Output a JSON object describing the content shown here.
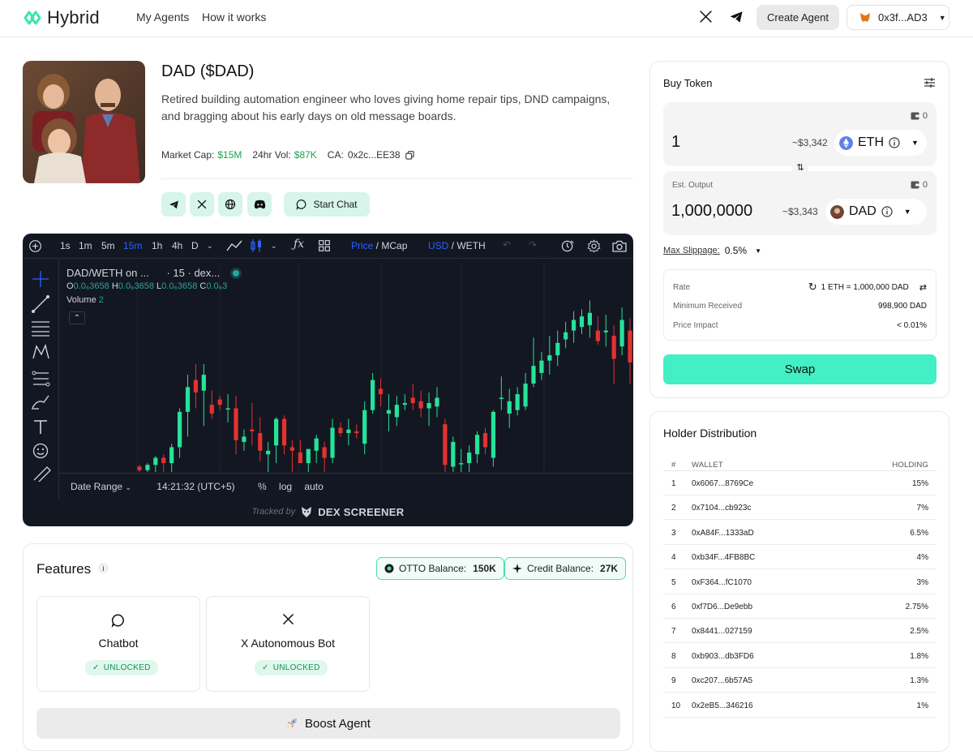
{
  "nav": {
    "brand": "Hybrid",
    "links": [
      "My Agents",
      "How it works"
    ],
    "create_label": "Create Agent",
    "wallet": "0x3f...AD3"
  },
  "agent": {
    "title": "DAD ($DAD)",
    "description": "Retired building automation engineer who loves giving home repair tips, DND campaigns, and bragging about his early days on old message boards.",
    "market_cap_label": "Market Cap:",
    "market_cap": "$15M",
    "vol_label": "24hr Vol:",
    "vol": "$87K",
    "ca_label": "CA:",
    "ca": "0x2c...EE38",
    "chat_label": "Start Chat"
  },
  "chart": {
    "intervals": [
      "1s",
      "1m",
      "5m",
      "15m",
      "1h",
      "4h",
      "D"
    ],
    "active_interval": "15m",
    "price_label": "Price",
    "mcap_label": "MCap",
    "usd_label": "USD",
    "weth_label": "WETH",
    "legend_pair": "DAD/WETH on ...",
    "legend_interval": "· 15 · dex...",
    "ohlc": {
      "o": "0.0₆3658",
      "h": "0.0₆3658",
      "l": "0.0₆3658",
      "c": "0.0₆3"
    },
    "volume_label": "Volume",
    "volume_value": "2",
    "date_range": "Date Range",
    "time": "14:21:32 (UTC+5)",
    "pct": "%",
    "log": "log",
    "auto": "auto",
    "tracked_by": "Tracked by",
    "tracked_brand": "DEX SCREENER",
    "colors": {
      "up": "#26e29a",
      "down": "#e5322f",
      "bg": "#131722"
    }
  },
  "chart_data": {
    "type": "candlestick",
    "title": "DAD/WETH",
    "candles": [
      {
        "o": 3,
        "h": 4,
        "l": 0,
        "c": 1
      },
      {
        "o": 1,
        "h": 5,
        "l": 0,
        "c": 4
      },
      {
        "o": 4,
        "h": 9,
        "l": 0,
        "c": 8
      },
      {
        "o": 8,
        "h": 10,
        "l": 0,
        "c": 5
      },
      {
        "o": 5,
        "h": 16,
        "l": 0,
        "c": 14
      },
      {
        "o": 14,
        "h": 36,
        "l": 8,
        "c": 34
      },
      {
        "o": 34,
        "h": 55,
        "l": 20,
        "c": 48
      },
      {
        "o": 52,
        "h": 61,
        "l": 36,
        "c": 45
      },
      {
        "o": 46,
        "h": 61,
        "l": 26,
        "c": 55
      },
      {
        "o": 38,
        "h": 46,
        "l": 30,
        "c": 33
      },
      {
        "o": 41,
        "h": 43,
        "l": 35,
        "c": 38
      },
      {
        "o": 36,
        "h": 44,
        "l": 28,
        "c": 36
      },
      {
        "o": 36,
        "h": 43,
        "l": 10,
        "c": 18
      },
      {
        "o": 17,
        "h": 24,
        "l": 12,
        "c": 20
      },
      {
        "o": 24,
        "h": 39,
        "l": 15,
        "c": 23
      },
      {
        "o": 22,
        "h": 31,
        "l": 6,
        "c": 12
      },
      {
        "o": 10,
        "h": 17,
        "l": 0,
        "c": 12
      },
      {
        "o": 15,
        "h": 31,
        "l": 5,
        "c": 30
      },
      {
        "o": 30,
        "h": 32,
        "l": 10,
        "c": 15
      },
      {
        "o": 14,
        "h": 18,
        "l": 0,
        "c": 12
      },
      {
        "o": 11,
        "h": 18,
        "l": 7,
        "c": 5
      },
      {
        "o": 5,
        "h": 13,
        "l": 0,
        "c": 13
      },
      {
        "o": 12,
        "h": 21,
        "l": 5,
        "c": 19
      },
      {
        "o": 14,
        "h": 17,
        "l": 0,
        "c": 8
      },
      {
        "o": 8,
        "h": 30,
        "l": 5,
        "c": 25
      },
      {
        "o": 25,
        "h": 28,
        "l": 20,
        "c": 22
      },
      {
        "o": 22,
        "h": 30,
        "l": 15,
        "c": 24
      },
      {
        "o": 23,
        "h": 27,
        "l": 19,
        "c": 22
      },
      {
        "o": 16,
        "h": 40,
        "l": 10,
        "c": 35
      },
      {
        "o": 35,
        "h": 56,
        "l": 33,
        "c": 52
      },
      {
        "o": 47,
        "h": 53,
        "l": 37,
        "c": 44
      },
      {
        "o": 33,
        "h": 44,
        "l": 23,
        "c": 35
      },
      {
        "o": 31,
        "h": 43,
        "l": 26,
        "c": 38
      },
      {
        "o": 38,
        "h": 44,
        "l": 35,
        "c": 39
      },
      {
        "o": 42,
        "h": 50,
        "l": 35,
        "c": 39
      },
      {
        "o": 40,
        "h": 46,
        "l": 31,
        "c": 36
      },
      {
        "o": 36,
        "h": 45,
        "l": 26,
        "c": 39
      },
      {
        "o": 37,
        "h": 48,
        "l": 31,
        "c": 42
      },
      {
        "o": 27,
        "h": 30,
        "l": 0,
        "c": 4
      },
      {
        "o": 3,
        "h": 20,
        "l": 0,
        "c": 17
      },
      {
        "o": 5,
        "h": 13,
        "l": 0,
        "c": 5
      },
      {
        "o": 5,
        "h": 15,
        "l": 0,
        "c": 11
      },
      {
        "o": 10,
        "h": 23,
        "l": 5,
        "c": 21
      },
      {
        "o": 22,
        "h": 25,
        "l": 10,
        "c": 14
      },
      {
        "o": 8,
        "h": 35,
        "l": 3,
        "c": 34
      },
      {
        "o": 42,
        "h": 54,
        "l": 35,
        "c": 42
      },
      {
        "o": 33,
        "h": 47,
        "l": 25,
        "c": 40
      },
      {
        "o": 35,
        "h": 48,
        "l": 32,
        "c": 44
      },
      {
        "o": 37,
        "h": 56,
        "l": 35,
        "c": 50
      },
      {
        "o": 50,
        "h": 76,
        "l": 48,
        "c": 60
      },
      {
        "o": 56,
        "h": 68,
        "l": 52,
        "c": 63
      },
      {
        "o": 63,
        "h": 77,
        "l": 55,
        "c": 66
      },
      {
        "o": 66,
        "h": 80,
        "l": 60,
        "c": 73
      },
      {
        "o": 75,
        "h": 85,
        "l": 70,
        "c": 79
      },
      {
        "o": 80,
        "h": 91,
        "l": 73,
        "c": 86
      },
      {
        "o": 82,
        "h": 92,
        "l": 78,
        "c": 88
      },
      {
        "o": 83,
        "h": 97,
        "l": 76,
        "c": 90
      },
      {
        "o": 80,
        "h": 88,
        "l": 72,
        "c": 74
      },
      {
        "o": 79,
        "h": 89,
        "l": 71,
        "c": 80
      },
      {
        "o": 77,
        "h": 83,
        "l": 50,
        "c": 64
      },
      {
        "o": 71,
        "h": 93,
        "l": 66,
        "c": 86
      },
      {
        "o": 80,
        "h": 87,
        "l": 50,
        "c": 62
      }
    ],
    "ylim": [
      0,
      100
    ]
  },
  "features": {
    "title": "Features",
    "otto_label": "OTTO Balance:",
    "otto_value": "150K",
    "credit_label": "Credit Balance:",
    "credit_value": "27K",
    "cards": [
      {
        "name": "Chatbot",
        "status": "UNLOCKED"
      },
      {
        "name": "X Autonomous Bot",
        "status": "UNLOCKED"
      }
    ],
    "boost_label": "Boost Agent"
  },
  "buy": {
    "title": "Buy Token",
    "input_balance": "0",
    "input_amount": "1",
    "input_usd": "~$3,342",
    "input_token": "ETH",
    "output_label": "Est. Output",
    "output_balance": "0",
    "output_amount": "1,000,0000",
    "output_usd": "~$3,343",
    "output_token": "DAD",
    "slippage_label": "Max Slippage:",
    "slippage_value": "0.5%",
    "rate_label": "Rate",
    "rate_value": "1 ETH = 1,000,000 DAD",
    "min_label": "Minimum Received",
    "min_value": "998,900 DAD",
    "impact_label": "Price Impact",
    "impact_value": "< 0.01%",
    "swap_label": "Swap",
    "colors": {
      "accent": "#43efc4",
      "eth": "#627eea"
    }
  },
  "holders": {
    "title": "Holder Distribution",
    "headers": [
      "#",
      "WALLET",
      "HOLDING"
    ],
    "rows": [
      [
        "1",
        "0x6067...8769Ce",
        "15%"
      ],
      [
        "2",
        "0x7104...cb923c",
        "7%"
      ],
      [
        "3",
        "0xA84F...1333aD",
        "6.5%"
      ],
      [
        "4",
        "0xb34F...4FB8BC",
        "4%"
      ],
      [
        "5",
        "0xF364...fC1070",
        "3%"
      ],
      [
        "6",
        "0xf7D6...De9ebb",
        "2.75%"
      ],
      [
        "7",
        "0x8441...027159",
        "2.5%"
      ],
      [
        "8",
        "0xb903...db3FD6",
        "1.8%"
      ],
      [
        "9",
        "0xc207...6b57A5",
        "1.3%"
      ],
      [
        "10",
        "0x2eB5...346216",
        "1%"
      ]
    ]
  }
}
